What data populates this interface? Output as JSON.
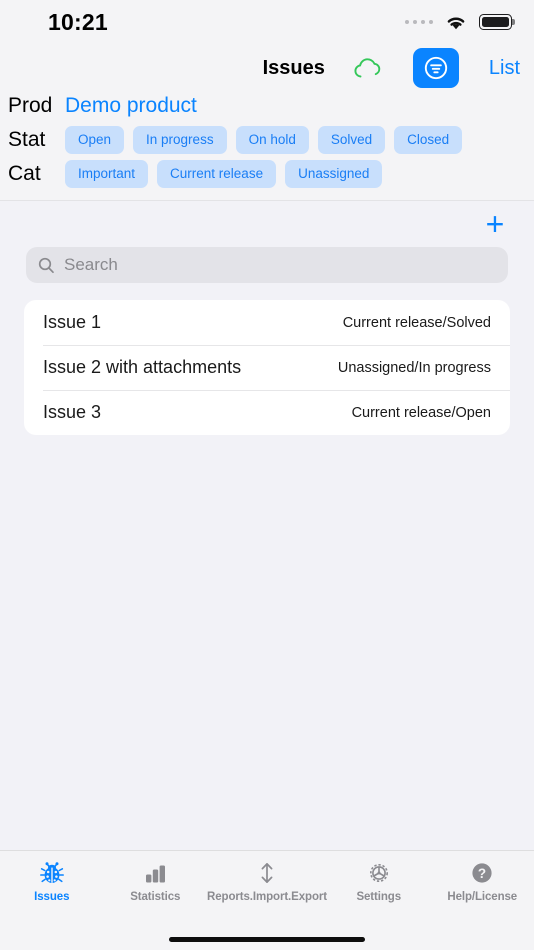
{
  "status_bar": {
    "time": "10:21",
    "cellular_icon": "cellular-dots-icon",
    "wifi_icon": "wifi-icon",
    "battery_icon": "battery-full-icon"
  },
  "navbar": {
    "title": "Issues",
    "cloud_icon": "cloud-icon",
    "cloud_color": "#34c759",
    "filter_icon": "filter-lines-circle-icon",
    "filter_button_color": "#0a84ff",
    "list_label": "List",
    "accent_color": "#0a84ff"
  },
  "filters": {
    "product": {
      "label": "Prod",
      "value": "Demo product"
    },
    "status": {
      "label": "Stat",
      "chips": [
        "Open",
        "In progress",
        "On hold",
        "Solved",
        "Closed"
      ]
    },
    "category": {
      "label": "Cat",
      "chips": [
        "Important",
        "Current release",
        "Unassigned"
      ]
    },
    "chip_bg": "#c8dffc",
    "chip_fg": "#1a7ef5"
  },
  "toolbar": {
    "add_label": "+",
    "add_icon": "plus-icon"
  },
  "search": {
    "placeholder": "Search",
    "value": "",
    "icon": "search-icon"
  },
  "issue_list": [
    {
      "title": "Issue 1",
      "meta": "Current release/Solved"
    },
    {
      "title": "Issue 2 with attachments",
      "meta": "Unassigned/In progress"
    },
    {
      "title": "Issue 3",
      "meta": "Current release/Open"
    }
  ],
  "tabbar": {
    "items": [
      {
        "label": "Issues",
        "icon": "ladybug-icon",
        "active": true
      },
      {
        "label": "Statistics",
        "icon": "bar-chart-icon",
        "active": false
      },
      {
        "label": "Reports.Import.Export",
        "icon": "up-down-arrow-icon",
        "active": false
      },
      {
        "label": "Settings",
        "icon": "gear-icon",
        "active": false
      },
      {
        "label": "Help/License",
        "icon": "question-mark-circle-icon",
        "active": false
      }
    ],
    "active_color": "#0a84ff",
    "inactive_color": "#8b8b90"
  }
}
